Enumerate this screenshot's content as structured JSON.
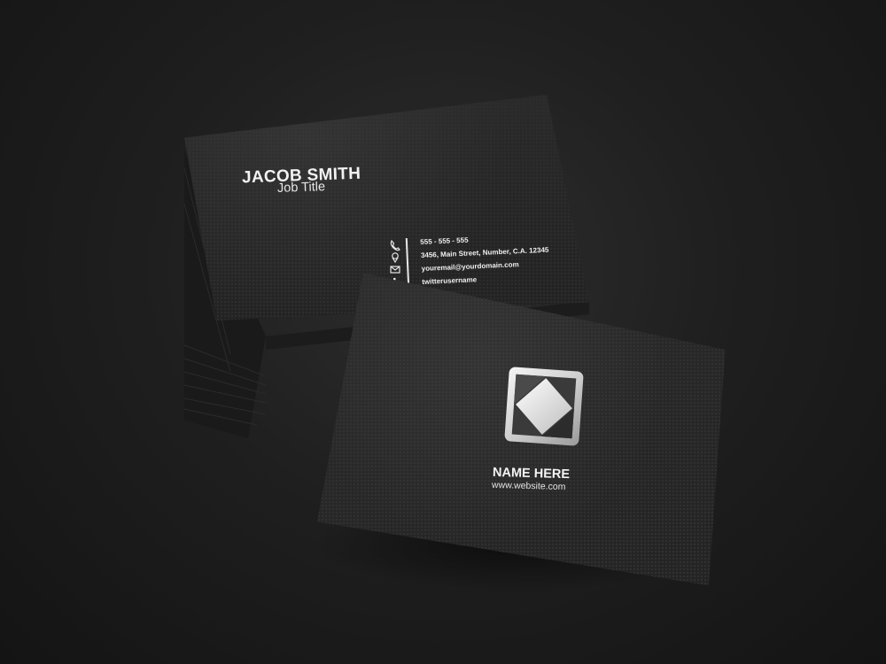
{
  "back_card": {
    "name": "JACOB SMITH",
    "job_title": "Job Title",
    "contact": {
      "phone": "555 - 555 - 555",
      "address": "3456, Main Street, Number, C.A. 12345",
      "email": "youremail@yourdomain.com",
      "twitter": "twitterusername"
    },
    "icons": [
      "phone-icon",
      "location-pin-icon",
      "envelope-icon",
      "twitter-icon"
    ]
  },
  "front_card": {
    "name": "NAME HERE",
    "website": "www.website.com",
    "logo": "diamond-square-logo"
  },
  "colors": {
    "background": "#1f1f1f",
    "card": "#262626",
    "text": "#f2f2f2"
  }
}
